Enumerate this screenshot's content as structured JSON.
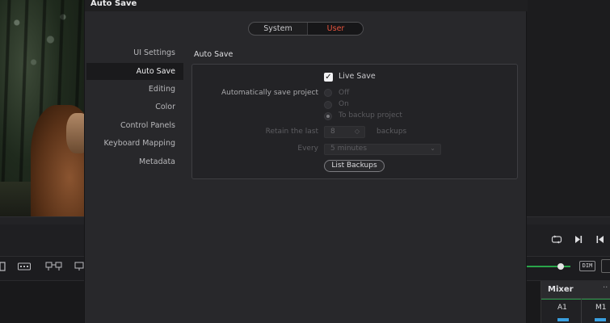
{
  "dialog": {
    "title": "Auto Save",
    "tabs": {
      "system": "System",
      "user": "User"
    },
    "sidebar": {
      "items": [
        "UI Settings",
        "Auto Save",
        "Editing",
        "Color",
        "Control Panels",
        "Keyboard Mapping",
        "Metadata"
      ],
      "active": "Auto Save"
    },
    "section_title": "Auto Save",
    "live_save": {
      "label": "Live Save",
      "checked": true
    },
    "auto_save_label": "Automatically save project",
    "radios": {
      "off": "Off",
      "on": "On",
      "backup": "To backup project",
      "selected": "To backup project"
    },
    "retain": {
      "label": "Retain the last",
      "value": "8",
      "suffix": "backups"
    },
    "every": {
      "label": "Every",
      "value": "5 minutes"
    },
    "list_backups": "List Backups"
  },
  "mixer": {
    "title": "Mixer",
    "channels": [
      "A1",
      "M1"
    ]
  },
  "colors": {
    "accent": "#e8543e",
    "meter_green": "#2aa54a",
    "meter_blue": "#3aa0e0"
  },
  "icons": {
    "loop": "loop-icon",
    "play_next": "next-frame-icon",
    "skip_end": "skip-to-end-icon",
    "dim": "DIM"
  }
}
